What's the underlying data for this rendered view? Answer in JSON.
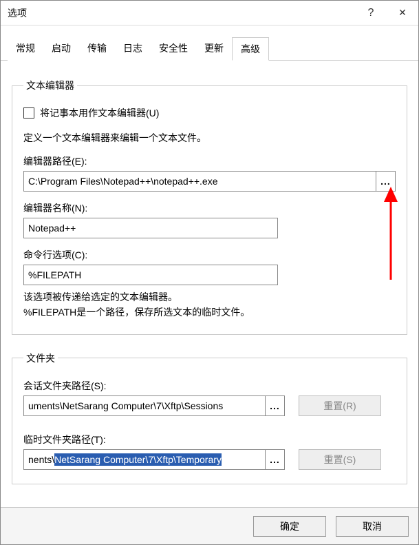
{
  "window": {
    "title": "选项"
  },
  "titlebar_icons": {
    "help": "?",
    "close": "✕"
  },
  "tabs": [
    "常规",
    "启动",
    "传输",
    "日志",
    "安全性",
    "更新",
    "高级"
  ],
  "active_tab_index": 6,
  "editor_group": {
    "legend": "文本编辑器",
    "use_notepad_label": "将记事本用作文本编辑器(U)",
    "define_hint": "定义一个文本编辑器来编辑一个文本文件。",
    "path_label": "编辑器路径(E):",
    "path_value": "C:\\Program Files\\Notepad++\\notepad++.exe",
    "browse_label": "...",
    "name_label": "编辑器名称(N):",
    "name_value": "Notepad++",
    "cmd_label": "命令行选项(C):",
    "cmd_value": "%FILEPATH",
    "cmd_hint1": "该选项被传递给选定的文本编辑器。",
    "cmd_hint2": "%FILEPATH是一个路径，保存所选文本的临时文件。"
  },
  "folder_group": {
    "legend": "文件夹",
    "session_label": "会话文件夹路径(S):",
    "session_value": "uments\\NetSarang Computer\\7\\Xftp\\Sessions",
    "session_reset": "重置(R)",
    "temp_label": "临时文件夹路径(T):",
    "temp_prefix": "nents\\",
    "temp_selected": "NetSarang Computer\\7\\Xftp\\Temporary",
    "temp_reset": "重置(S)",
    "browse_label": "..."
  },
  "buttons": {
    "ok": "确定",
    "cancel": "取消"
  }
}
